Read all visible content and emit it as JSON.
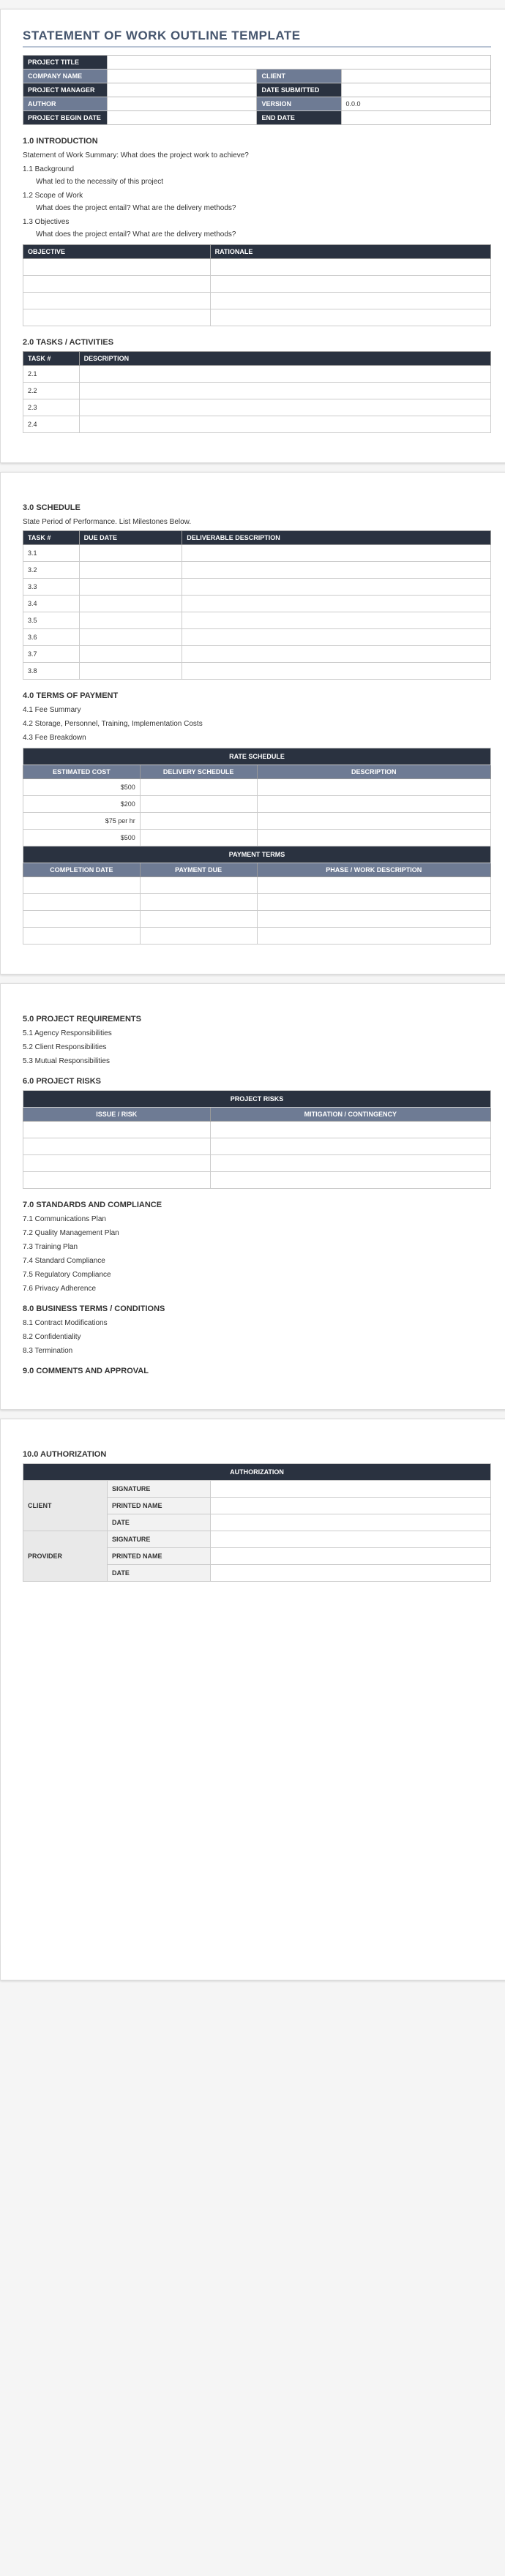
{
  "title": "STATEMENT OF WORK OUTLINE TEMPLATE",
  "meta": {
    "projectTitle": "PROJECT TITLE",
    "projectTitleVal": "",
    "companyName": "COMPANY NAME",
    "companyNameVal": "",
    "client": "CLIENT",
    "clientVal": "",
    "projectManager": "PROJECT MANAGER",
    "projectManagerVal": "",
    "dateSubmitted": "DATE SUBMITTED",
    "dateSubmittedVal": "",
    "author": "AUTHOR",
    "authorVal": "",
    "version": "VERSION",
    "versionVal": "0.0.0",
    "beginDate": "PROJECT BEGIN DATE",
    "beginDateVal": "",
    "endDate": "END DATE",
    "endDateVal": ""
  },
  "s1": {
    "head": "1.0 INTRODUCTION",
    "summary": "Statement of Work Summary: What does the project work to achieve?",
    "b1": "1.1 Background",
    "b1t": "What led to the necessity of this project",
    "b2": "1.2 Scope of Work",
    "b2t": "What does the project entail? What are the delivery methods?",
    "b3": "1.3 Objectives",
    "b3t": "What does the project entail? What are the delivery methods?",
    "objHead": "OBJECTIVE",
    "ratHead": "RATIONALE"
  },
  "s2": {
    "head": "2.0 TASKS / ACTIVITIES",
    "c1": "TASK #",
    "c2": "DESCRIPTION",
    "rows": [
      "2.1",
      "2.2",
      "2.3",
      "2.4"
    ]
  },
  "s3": {
    "head": "3.0 SCHEDULE",
    "intro": "State Period of Performance. List Milestones Below.",
    "c1": "TASK #",
    "c2": "DUE DATE",
    "c3": "DELIVERABLE DESCRIPTION",
    "rows": [
      "3.1",
      "3.2",
      "3.3",
      "3.4",
      "3.5",
      "3.6",
      "3.7",
      "3.8"
    ]
  },
  "s4": {
    "head": "4.0 TERMS OF PAYMENT",
    "i1": "4.1 Fee Summary",
    "i2": "4.2 Storage, Personnel, Training, Implementation Costs",
    "i3": "4.3 Fee Breakdown",
    "rateTitle": "RATE SCHEDULE",
    "rc1": "ESTIMATED COST",
    "rc2": "DELIVERY SCHEDULE",
    "rc3": "DESCRIPTION",
    "rates": [
      "$500",
      "$200",
      "$75 per hr",
      "$500"
    ],
    "payTitle": "PAYMENT TERMS",
    "pc1": "COMPLETION DATE",
    "pc2": "PAYMENT DUE",
    "pc3": "PHASE / WORK DESCRIPTION"
  },
  "s5": {
    "head": "5.0 PROJECT REQUIREMENTS",
    "i": [
      "5.1 Agency Responsibilities",
      "5.2 Client Responsibilities",
      "5.3 Mutual Responsibilities"
    ]
  },
  "s6": {
    "head": "6.0 PROJECT RISKS",
    "title": "PROJECT RISKS",
    "c1": "ISSUE / RISK",
    "c2": "MITIGATION / CONTINGENCY"
  },
  "s7": {
    "head": "7.0 STANDARDS AND COMPLIANCE",
    "i": [
      "7.1 Communications Plan",
      "7.2 Quality Management Plan",
      "7.3 Training Plan",
      "7.4 Standard Compliance",
      "7.5 Regulatory Compliance",
      "7.6 Privacy Adherence"
    ]
  },
  "s8": {
    "head": "8.0 BUSINESS TERMS / CONDITIONS",
    "i": [
      "8.1 Contract Modifications",
      "8.2 Confidentiality",
      "8.3 Termination"
    ]
  },
  "s9": {
    "head": "9.0 COMMENTS AND APPROVAL"
  },
  "s10": {
    "head": "10.0  AUTHORIZATION",
    "title": "AUTHORIZATION",
    "client": "CLIENT",
    "provider": "PROVIDER",
    "sig": "SIGNATURE",
    "name": "PRINTED NAME",
    "date": "DATE"
  }
}
